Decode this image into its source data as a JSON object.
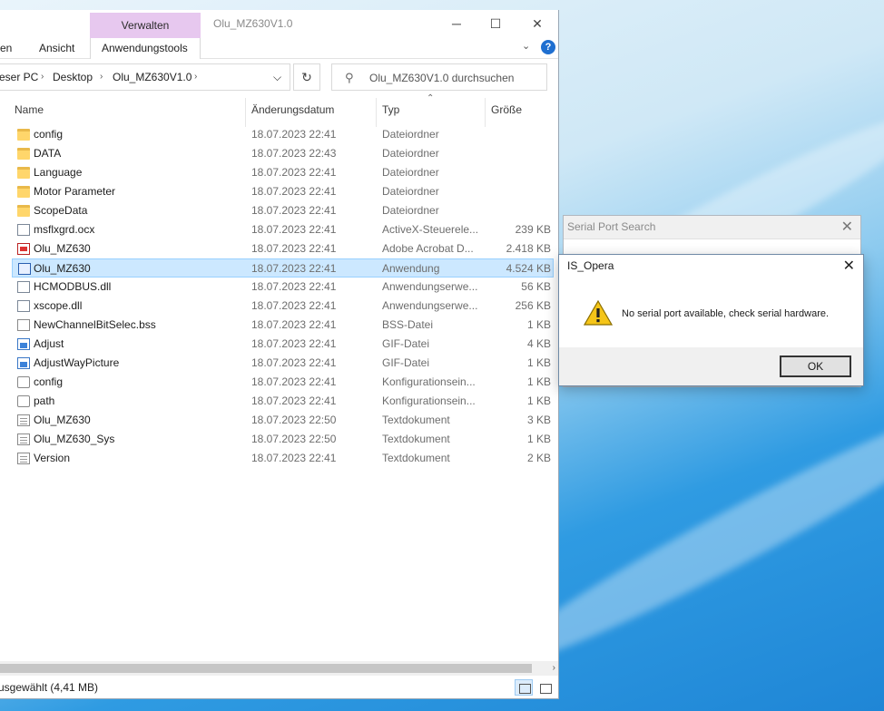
{
  "explorer": {
    "title": "Olu_MZ630V1.0",
    "ribbon": {
      "tab_partial_left": "en",
      "tab_view": "Ansicht",
      "context_group": "Verwalten",
      "context_tab": "Anwendungstools"
    },
    "address": {
      "segments": [
        "eser PC",
        "Desktop",
        "Olu_MZ630V1.0"
      ],
      "sep": "›"
    },
    "search": {
      "placeholder": "Olu_MZ630V1.0 durchsuchen"
    },
    "columns": {
      "name": "Name",
      "date": "Änderungsdatum",
      "type": "Typ",
      "size": "Größe"
    },
    "files": [
      {
        "name": "config",
        "date": "18.07.2023 22:41",
        "type": "Dateiordner",
        "size": "",
        "icon": "folder-icon"
      },
      {
        "name": "DATA",
        "date": "18.07.2023 22:43",
        "type": "Dateiordner",
        "size": "",
        "icon": "folder-icon"
      },
      {
        "name": "Language",
        "date": "18.07.2023 22:41",
        "type": "Dateiordner",
        "size": "",
        "icon": "folder-icon"
      },
      {
        "name": "Motor Parameter",
        "date": "18.07.2023 22:41",
        "type": "Dateiordner",
        "size": "",
        "icon": "folder-icon"
      },
      {
        "name": "ScopeData",
        "date": "18.07.2023 22:41",
        "type": "Dateiordner",
        "size": "",
        "icon": "folder-icon"
      },
      {
        "name": "msflxgrd.ocx",
        "date": "18.07.2023 22:41",
        "type": "ActiveX-Steuerele...",
        "size": "239 KB",
        "icon": "activex-icon"
      },
      {
        "name": "Olu_MZ630",
        "date": "18.07.2023 22:41",
        "type": "Adobe Acrobat D...",
        "size": "2.418 KB",
        "icon": "pdf-icon"
      },
      {
        "name": "Olu_MZ630",
        "date": "18.07.2023 22:41",
        "type": "Anwendung",
        "size": "4.524 KB",
        "icon": "app-icon",
        "selected": true
      },
      {
        "name": "HCMODBUS.dll",
        "date": "18.07.2023 22:41",
        "type": "Anwendungserwe...",
        "size": "56 KB",
        "icon": "dll-icon"
      },
      {
        "name": "xscope.dll",
        "date": "18.07.2023 22:41",
        "type": "Anwendungserwe...",
        "size": "256 KB",
        "icon": "dll-icon"
      },
      {
        "name": "NewChannelBitSelec.bss",
        "date": "18.07.2023 22:41",
        "type": "BSS-Datei",
        "size": "1 KB",
        "icon": "file-icon"
      },
      {
        "name": "Adjust",
        "date": "18.07.2023 22:41",
        "type": "GIF-Datei",
        "size": "4 KB",
        "icon": "gif-icon"
      },
      {
        "name": "AdjustWayPicture",
        "date": "18.07.2023 22:41",
        "type": "GIF-Datei",
        "size": "1 KB",
        "icon": "gif-icon"
      },
      {
        "name": "config",
        "date": "18.07.2023 22:41",
        "type": "Konfigurationsein...",
        "size": "1 KB",
        "icon": "config-icon"
      },
      {
        "name": "path",
        "date": "18.07.2023 22:41",
        "type": "Konfigurationsein...",
        "size": "1 KB",
        "icon": "config-icon"
      },
      {
        "name": "Olu_MZ630",
        "date": "18.07.2023 22:50",
        "type": "Textdokument",
        "size": "3 KB",
        "icon": "text-file-icon"
      },
      {
        "name": "Olu_MZ630_Sys",
        "date": "18.07.2023 22:50",
        "type": "Textdokument",
        "size": "1 KB",
        "icon": "text-file-icon"
      },
      {
        "name": "Version",
        "date": "18.07.2023 22:41",
        "type": "Textdokument",
        "size": "2 KB",
        "icon": "text-file-icon"
      }
    ],
    "status_text": "usgewählt (4,41 MB)"
  },
  "serial_search": {
    "title": "Serial Port Search"
  },
  "message_box": {
    "title": "IS_Opera",
    "message": "No serial port available, check serial hardware.",
    "ok_label": "OK",
    "icon": "warning-icon"
  }
}
